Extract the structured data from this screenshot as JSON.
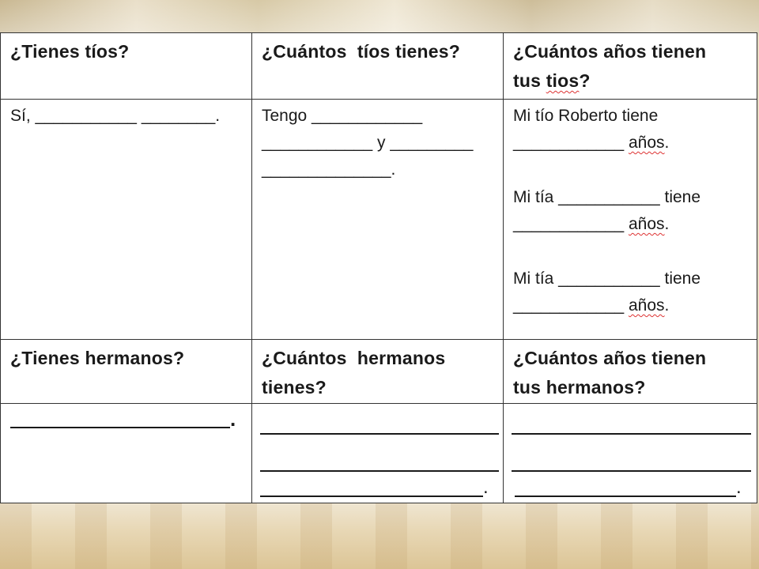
{
  "table": {
    "row1": {
      "col1_header": "¿Tienes tíos?",
      "col2_header": "¿Cuántos  tíos tienes?",
      "col3_header_line1": "¿Cuántos años tienen",
      "col3_header_line2_prefix": "tus ",
      "col3_header_line2_word": "tios",
      "col3_header_line2_suffix": "?"
    },
    "row2": {
      "col1_text": "Sí, ___________ ________.",
      "col2_line1": "Tengo ____________",
      "col2_line2": "____________ y _________",
      "col2_line3": "______________.",
      "col3_entry1_line1": "Mi tío Roberto tiene",
      "col3_entry1_blank": "____________",
      "col3_entry1_word": "años",
      "col3_entry1_end": ".",
      "col3_entry2_line1": "Mi tía ___________ tiene",
      "col3_entry2_blank": "____________",
      "col3_entry2_word": "años",
      "col3_entry2_end": ".",
      "col3_entry3_line1": "Mi tía ___________ tiene",
      "col3_entry3_blank": "____________",
      "col3_entry3_word": "años",
      "col3_entry3_end": "."
    },
    "row3": {
      "col1_header": "¿Tienes hermanos?",
      "col2_header_line1": "¿Cuántos  hermanos",
      "col2_header_line2": "tienes?",
      "col3_header_line1": "¿Cuántos años tienen",
      "col3_header_line2": "tus hermanos?"
    },
    "row4": {
      "col1_end": ".",
      "col2_end": ".",
      "col3_end": "."
    }
  }
}
